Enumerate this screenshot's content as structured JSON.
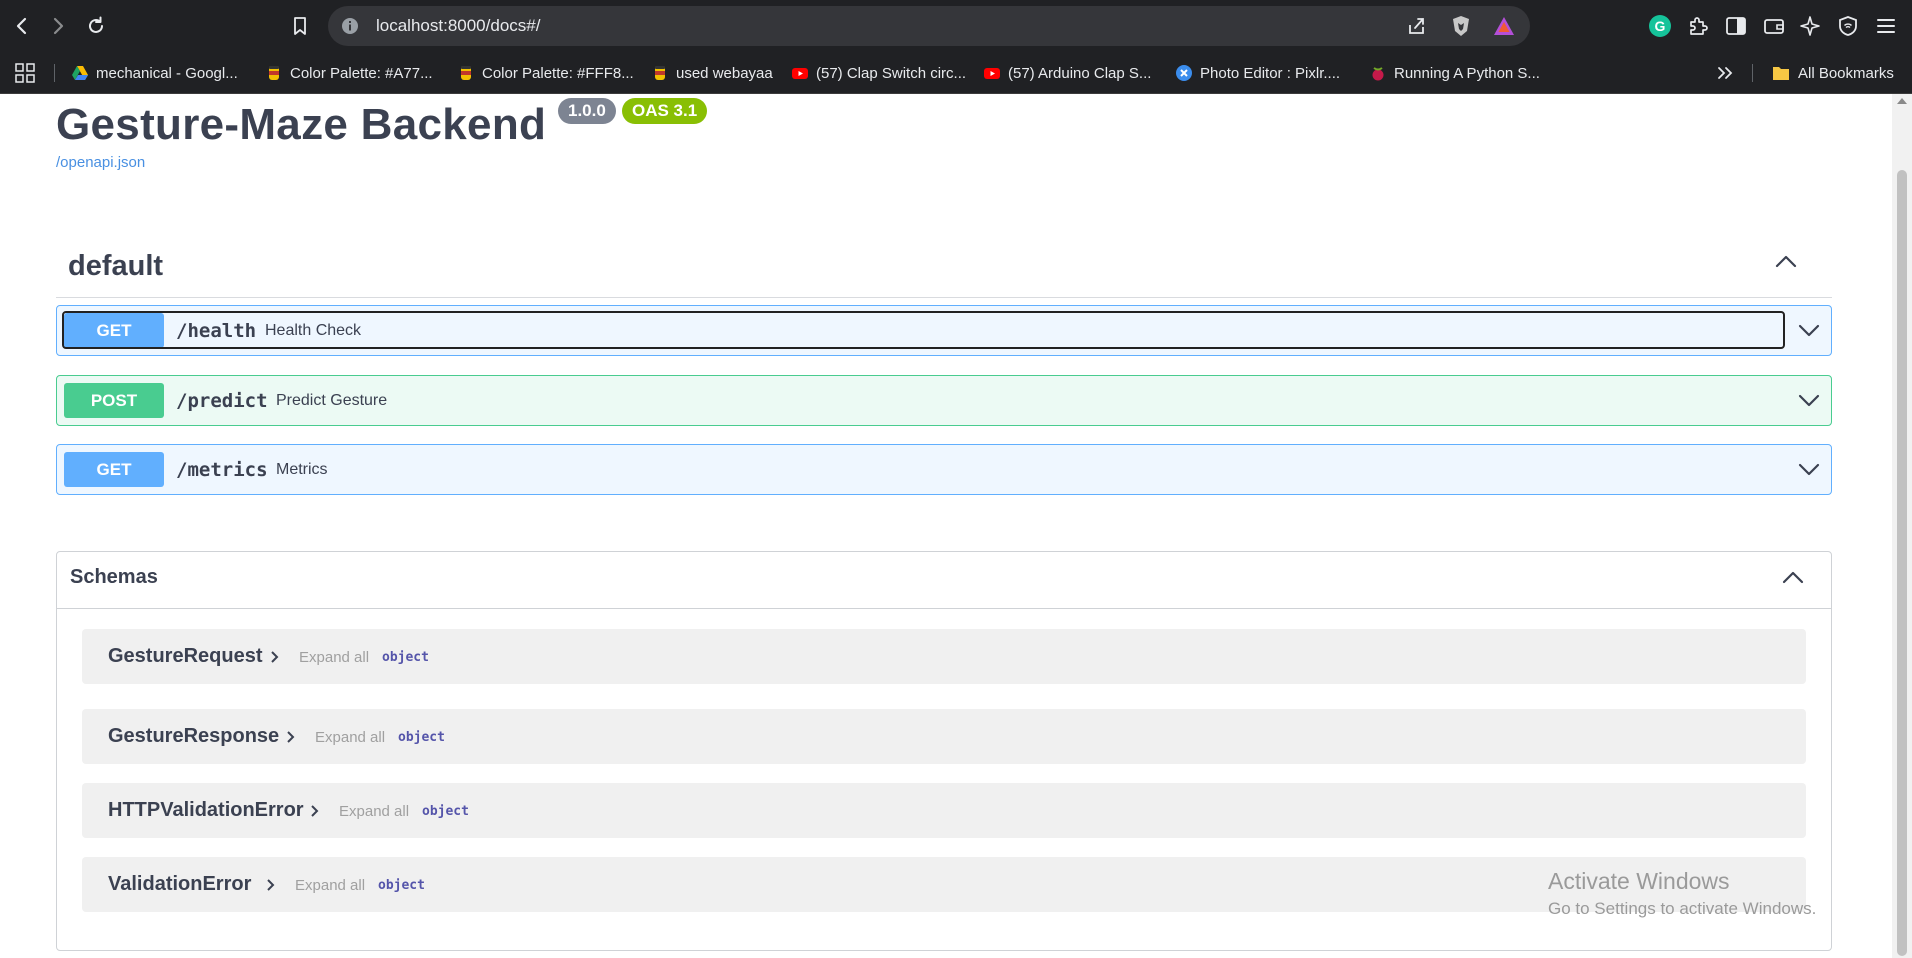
{
  "browser": {
    "url": "localhost:8000/docs#/",
    "bookmarks": [
      {
        "label": "mechanical - Googl...",
        "icon": "google-drive-icon"
      },
      {
        "label": "Color Palette: #A77...",
        "icon": "palette-favicon-icon"
      },
      {
        "label": "Color Palette: #FFF8...",
        "icon": "palette-favicon-icon"
      },
      {
        "label": "used webayaa",
        "icon": "palette-favicon-icon"
      },
      {
        "label": "(57) Clap Switch circ...",
        "icon": "youtube-icon"
      },
      {
        "label": "(57) Arduino Clap S...",
        "icon": "youtube-icon"
      },
      {
        "label": "Photo Editor : Pixlr....",
        "icon": "pixlr-icon"
      },
      {
        "label": "Running A Python S...",
        "icon": "raspberry-icon"
      }
    ],
    "all_bookmarks_label": "All Bookmarks",
    "colors": {
      "chrome_bg": "#202124",
      "urlbar_bg": "#35363a",
      "text": "#e8eaed"
    }
  },
  "api": {
    "title": "Gesture-Maze Backend",
    "version": "1.0.0",
    "oas": "OAS 3.1",
    "spec_link": "/openapi.json"
  },
  "section": {
    "title": "default",
    "operations": [
      {
        "method": "GET",
        "path": "/health",
        "summary": "Health Check"
      },
      {
        "method": "POST",
        "path": "/predict",
        "summary": "Predict Gesture"
      },
      {
        "method": "GET",
        "path": "/metrics",
        "summary": "Metrics"
      }
    ]
  },
  "schemas": {
    "title": "Schemas",
    "items": [
      {
        "name": "GestureRequest",
        "expand_label": "Expand all",
        "type": "object"
      },
      {
        "name": "GestureResponse",
        "expand_label": "Expand all",
        "type": "object"
      },
      {
        "name": "HTTPValidationError",
        "expand_label": "Expand all",
        "type": "object"
      },
      {
        "name": "ValidationError",
        "expand_label": "Expand all",
        "type": "object"
      }
    ]
  },
  "watermark": {
    "line1": "Activate Windows",
    "line2": "Go to Settings to activate Windows."
  },
  "colors": {
    "get": "#61affe",
    "post": "#49cc90",
    "title_text": "#3b4151",
    "link": "#4990e2",
    "oas_badge": "#89bf04",
    "version_badge": "#7d8492"
  }
}
